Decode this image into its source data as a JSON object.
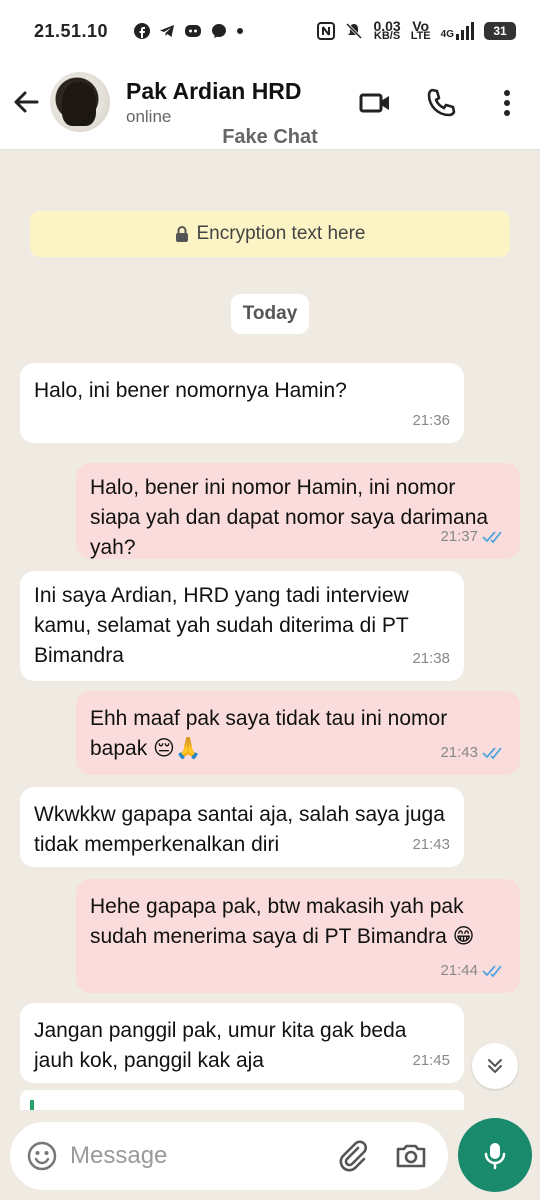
{
  "status_bar": {
    "time": "21.51.10",
    "app_icons": [
      "facebook-icon",
      "telegram-icon",
      "discord-icon",
      "messenger-icon",
      "dot-icon"
    ],
    "data_speed_value": "0.03",
    "data_speed_unit": "KB/S",
    "volte_top": "Vo",
    "volte_bottom": "LTE",
    "network": "4G",
    "battery": "31"
  },
  "header": {
    "contact_name": "Pak Ardian HRD",
    "contact_status": "online",
    "watermark": "Fake Chat"
  },
  "chat": {
    "encryption_text": "Encryption text here",
    "date_label": "Today",
    "messages": [
      {
        "direction": "in",
        "text": "Halo, ini bener nomornya Hamin?",
        "time": "21:36"
      },
      {
        "direction": "out",
        "text": "Halo, bener ini nomor Hamin, ini nomor siapa yah dan dapat nomor saya darimana yah?",
        "time": "21:37",
        "read": true
      },
      {
        "direction": "in",
        "text": "Ini saya Ardian, HRD yang tadi interview kamu, selamat yah sudah diterima di PT Bimandra",
        "time": "21:38"
      },
      {
        "direction": "out",
        "text": "Ehh maaf pak saya tidak tau ini nomor bapak 😔🙏",
        "time": "21:43",
        "read": true
      },
      {
        "direction": "in",
        "text": "Wkwkkw gapapa santai aja, salah saya juga tidak memperkenalkan diri",
        "time": "21:43"
      },
      {
        "direction": "out",
        "text": "Hehe gapapa pak, btw makasih yah pak sudah menerima saya di PT Bimandra 😁",
        "time": "21:44",
        "read": true
      },
      {
        "direction": "in",
        "text": "Jangan panggil pak, umur kita gak beda jauh kok, panggil kak aja",
        "time": "21:45"
      }
    ]
  },
  "composer": {
    "placeholder": "Message"
  },
  "colors": {
    "outgoing_bubble": "#fbdcdc",
    "incoming_bubble": "#ffffff",
    "chat_background": "#efeae2",
    "encryption_banner": "#fdf4c5",
    "accent": "#1a8a6c",
    "read_ticks": "#4fa3e0"
  }
}
